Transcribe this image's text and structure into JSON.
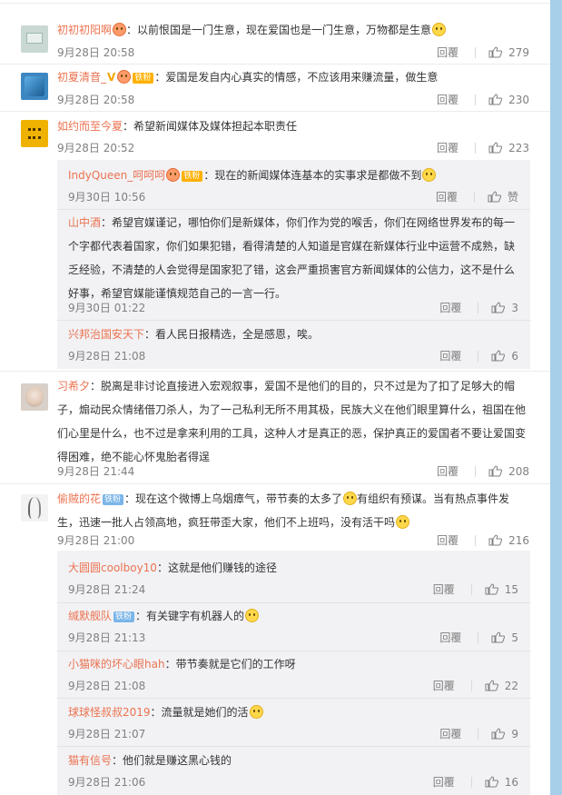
{
  "ui": {
    "reply_label": "回覆"
  },
  "comments": [
    {
      "user": "初初初阳啊",
      "vip": false,
      "badge": "",
      "text": "：以前恨国是一门生意，现在爱国也是一门生意，万物都是生意",
      "time": "9月28日 20:58",
      "likes": "279"
    },
    {
      "user": "初夏清音_",
      "vip": true,
      "badge": "铁粉",
      "text": "：爱国是发自内心真实的情感，不应该用来赚流量，做生意",
      "time": "9月28日 20:58",
      "likes": "230"
    },
    {
      "user": "如约而至今夏",
      "vip": false,
      "badge": "",
      "text": "：希望新闻媒体及媒体担起本职责任",
      "time": "9月28日 20:52",
      "likes": "223"
    },
    {
      "user": "IndyQueen_呵呵呵",
      "vip": false,
      "badge": "铁粉",
      "text": "：现在的新闻媒体连基本的实事求是都做不到",
      "time": "9月30日 10:56",
      "likes": "赞"
    },
    {
      "user": "山中酒",
      "vip": false,
      "badge": "",
      "text": "：希望官媒谨记，哪怕你们是新媒体，你们作为党的喉舌，你们在网络世界发布的每一个字都代表着国家，你们如果犯错，看得清楚的人知道是官媒在新媒体行业中运营不成熟，缺乏经验，不清楚的人会觉得是国家犯了错，这会严重损害官方新闻媒体的公信力，这不是什么好事，希望官媒能谨慎规范自己的一言一行。",
      "time": "9月30日 01:22",
      "likes": "3"
    },
    {
      "user": "兴邦治国安天下",
      "vip": false,
      "badge": "",
      "text": "：看人民日报精选，全是感恩，唉。",
      "time": "9月28日 21:08",
      "likes": "6"
    },
    {
      "user": "习希夕",
      "vip": false,
      "badge": "",
      "text": "：脱离是非讨论直接进入宏观叙事，爱国不是他们的目的，只不过是为了扣了足够大的帽子，煽动民众情绪借刀杀人，为了一己私利无所不用其极，民族大义在他们眼里算什么，祖国在他们心里是什么，也不过是拿来利用的工具，这种人才是真正的恶，保护真正的爱国者不要让爱国变得困难，绝不能心怀鬼胎者得逞",
      "time": "9月28日 21:44",
      "likes": "208"
    },
    {
      "user": "偷贼的花",
      "vip": false,
      "badge": "铁粉",
      "text_a": "：现在这个微博上乌烟瘴气，带节奏的太多了",
      "text_b": "有组织有预谋。当有热点事件发生，迅速一批人占领高地，疯狂带歪大家，他们不上班吗，没有活干吗",
      "time": "9月28日 21:00",
      "likes": "216"
    },
    {
      "user": "大圆圆coolboy10",
      "vip": false,
      "badge": "",
      "text": "：这就是他们赚钱的途径",
      "time": "9月28日 21:24",
      "likes": "15"
    },
    {
      "user": "缄默舰队",
      "vip": false,
      "badge": "铁粉",
      "text": "：有关键字有机器人的",
      "time": "9月28日 21:13",
      "likes": "5"
    },
    {
      "user": "小猫咪的坏心眼hah",
      "vip": false,
      "badge": "",
      "text": "：带节奏就是它们的工作呀",
      "time": "9月28日 21:08",
      "likes": "22"
    },
    {
      "user": "球球怪叔叔2019",
      "vip": false,
      "badge": "",
      "text": "：流量就是她们的活",
      "time": "9月28日 21:07",
      "likes": "9"
    },
    {
      "user": "猫有信号",
      "vip": false,
      "badge": "",
      "text": "：他们就是赚这黑心钱的",
      "time": "9月28日 21:06",
      "likes": "16"
    }
  ]
}
